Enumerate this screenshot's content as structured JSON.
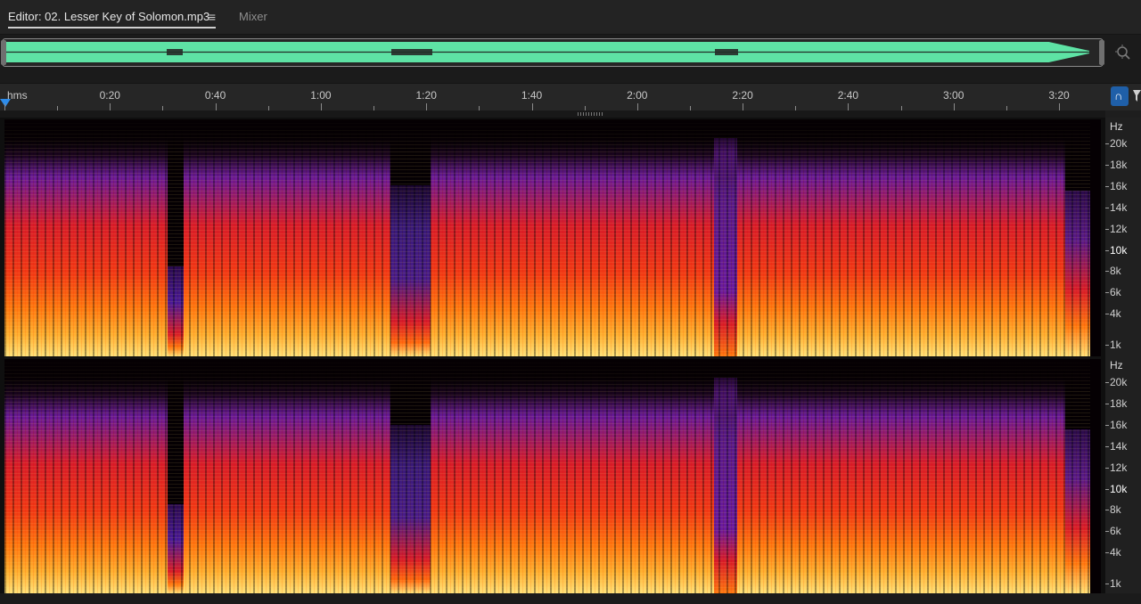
{
  "tabs": {
    "editor_label": "Editor: 02. Lesser Key of Solomon.mp3",
    "menu_icon": "≡",
    "mixer_label": "Mixer"
  },
  "overview": {
    "waveform_color": "#5ee3a5",
    "zoom_icon": "zoom-navigator-icon"
  },
  "ruler": {
    "format_label": "hms",
    "ticks": [
      "0:20",
      "0:40",
      "1:00",
      "1:20",
      "1:40",
      "2:00",
      "2:20",
      "2:40",
      "3:00",
      "3:20"
    ],
    "snap_icon": "snap-magnet-icon",
    "accent": "#2d8ceb"
  },
  "spectral": {
    "channel_1": {
      "unit": "Hz",
      "labels": [
        "20k",
        "18k",
        "16k",
        "14k",
        "12k",
        "10k",
        "8k",
        "6k",
        "4k",
        "1k"
      ]
    },
    "channel_2": {
      "unit": "Hz",
      "labels": [
        "20k",
        "18k",
        "16k",
        "14k",
        "12k",
        "10k",
        "8k",
        "6k",
        "4k",
        "1k"
      ]
    },
    "colors": {
      "hot": "#ffe27a",
      "warm": "#ff7a10",
      "mid": "#d81c2a",
      "cool": "#6a1a9a",
      "silence": "#050003"
    }
  }
}
